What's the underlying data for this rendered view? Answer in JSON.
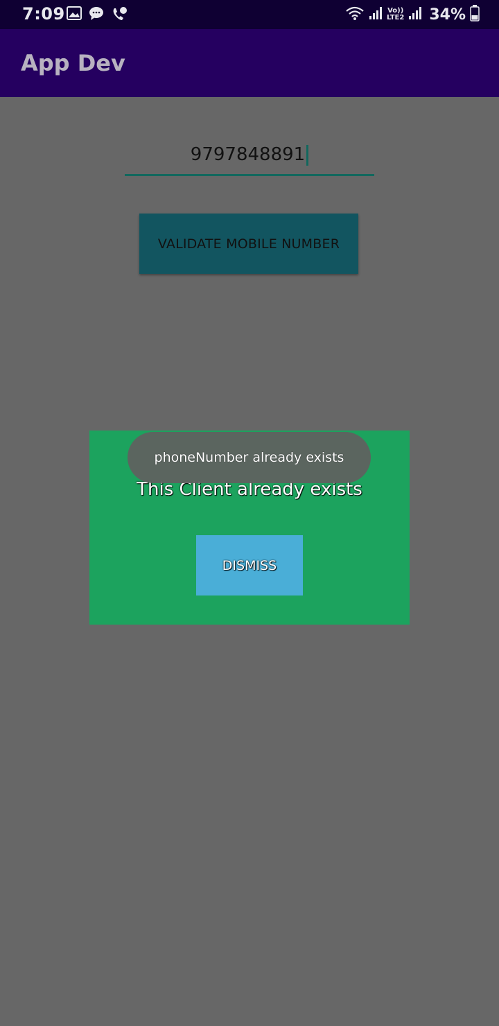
{
  "status_bar": {
    "time": "7:09",
    "battery": "34%",
    "network_top": "Vo))",
    "network_bottom": "LTE2",
    "icons": [
      "image-icon",
      "chat-icon",
      "missed-call-icon",
      "wifi-icon",
      "signal-icon",
      "battery-icon"
    ]
  },
  "app_bar": {
    "title": "App Dev",
    "color": "#250060"
  },
  "form": {
    "phone_value": "9797848891",
    "validate_label": "VALIDATE MOBILE NUMBER"
  },
  "dialog": {
    "message": "This Client already exists",
    "dismiss_label": "DISMISS",
    "background": "#1ca35e"
  },
  "toast": {
    "text": "phoneNumber already exists"
  }
}
